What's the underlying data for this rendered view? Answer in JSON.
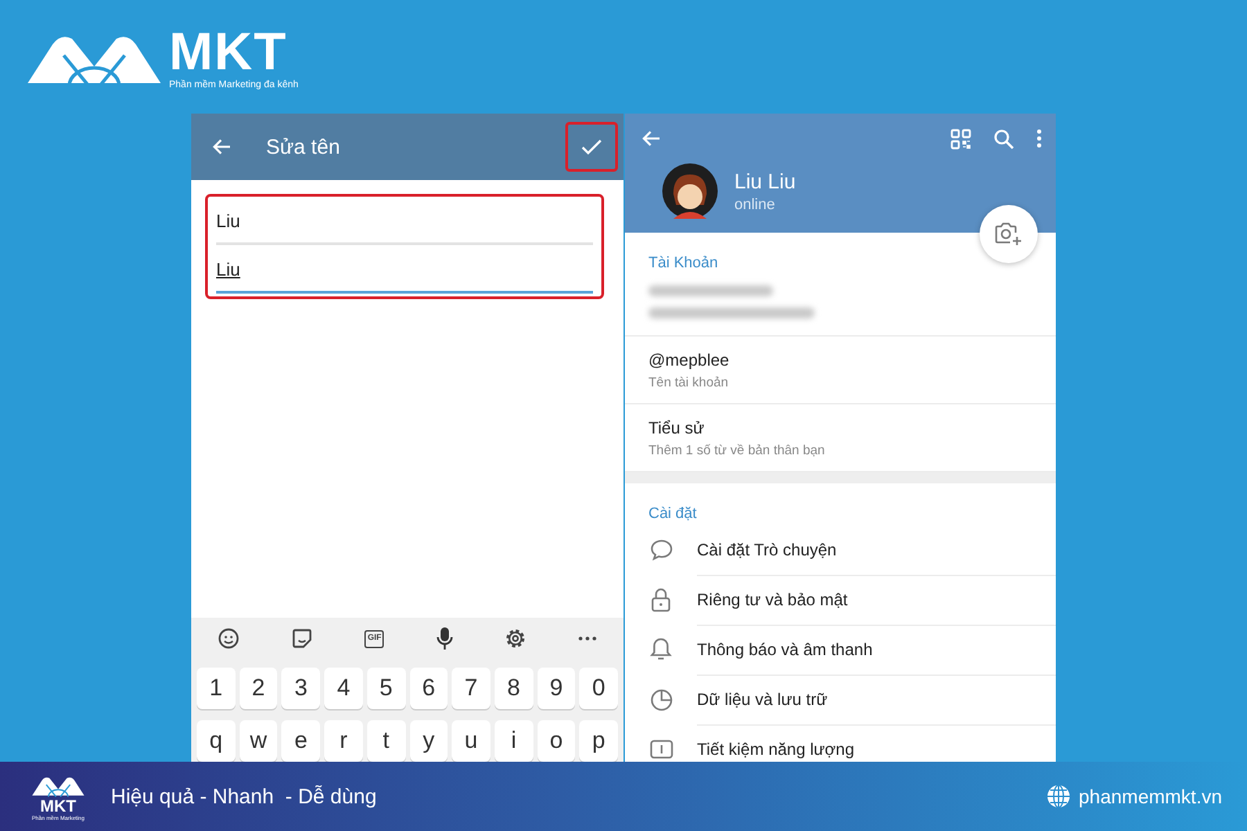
{
  "logo": {
    "name": "MKT",
    "tagline": "Phần mềm Marketing đa kênh"
  },
  "edit_name": {
    "title": "Sửa tên",
    "fields": [
      {
        "value": "Liu",
        "focused": false
      },
      {
        "value": "Liu",
        "focused": true
      }
    ],
    "keyboard": {
      "toolbar": [
        {
          "kind": "emoji"
        },
        {
          "kind": "sticker"
        },
        {
          "kind": "gif",
          "label": "GIF"
        },
        {
          "kind": "mic"
        },
        {
          "kind": "settings"
        },
        {
          "kind": "more"
        }
      ],
      "number_row": [
        "1",
        "2",
        "3",
        "4",
        "5",
        "6",
        "7",
        "8",
        "9",
        "0"
      ],
      "letter_row": [
        "q",
        "w",
        "e",
        "r",
        "t",
        "y",
        "u",
        "i",
        "o",
        "p"
      ]
    }
  },
  "profile": {
    "name": "Liu Liu",
    "status": "online",
    "account_title": "Tài Khoản",
    "account_items": [
      {
        "value": "@mepblee",
        "caption": "Tên tài khoản"
      },
      {
        "value": "Tiểu sử",
        "caption": "Thêm 1 số từ về bản thân bạn"
      }
    ],
    "settings_title": "Cài đặt",
    "settings_items": [
      {
        "kind": "chat",
        "label": "Cài đặt Trò chuyện"
      },
      {
        "kind": "lock",
        "label": "Riêng tư và bảo mật"
      },
      {
        "kind": "bell",
        "label": "Thông báo và âm thanh"
      },
      {
        "kind": "clock",
        "label": "Dữ liệu và lưu trữ"
      },
      {
        "kind": "battery",
        "label": "Tiết kiệm năng lượng"
      }
    ]
  },
  "banner": {
    "logo_name": "MKT",
    "logo_tagline": "Phần mềm Marketing",
    "slogan": "Hiệu quả - Nhanh  - Dễ dùng",
    "website": "phanmemmkt.vn"
  }
}
